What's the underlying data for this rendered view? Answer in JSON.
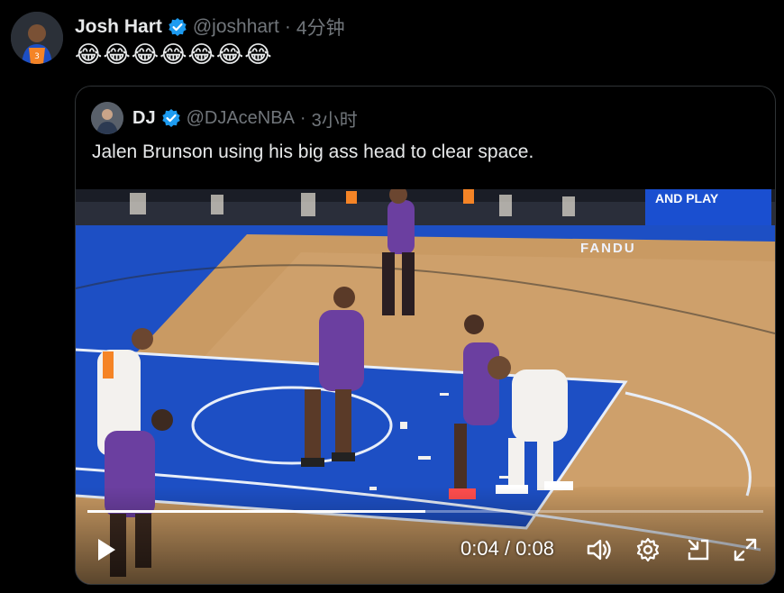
{
  "post": {
    "author_name": "Josh Hart",
    "author_handle": "@joshhart",
    "separator": "·",
    "time": "4分钟",
    "text": "😂😂😂😂😂😂😂"
  },
  "quoted": {
    "author_name": "DJ",
    "author_handle": "@DJAceNBA",
    "separator": "·",
    "time": "3小时",
    "text": "Jalen Brunson using his big ass head to clear space."
  },
  "video": {
    "current_time": "0:04",
    "duration": "0:08",
    "time_separator": " / ",
    "progress": 0.5,
    "signage_top": "AND PLAY",
    "signage_side": "FANDU"
  },
  "icons": {
    "verified": "verified-badge-icon",
    "play": "play-icon",
    "volume": "volume-icon",
    "settings": "gear-icon",
    "pip": "picture-in-picture-icon",
    "fullscreen": "fullscreen-icon"
  },
  "colors": {
    "verified_blue": "#1d9bf0",
    "muted_text": "#71767b",
    "court_blue": "#1d4fc4",
    "court_wood": "#c99a63",
    "raptors_purple": "#6b3fa0"
  }
}
